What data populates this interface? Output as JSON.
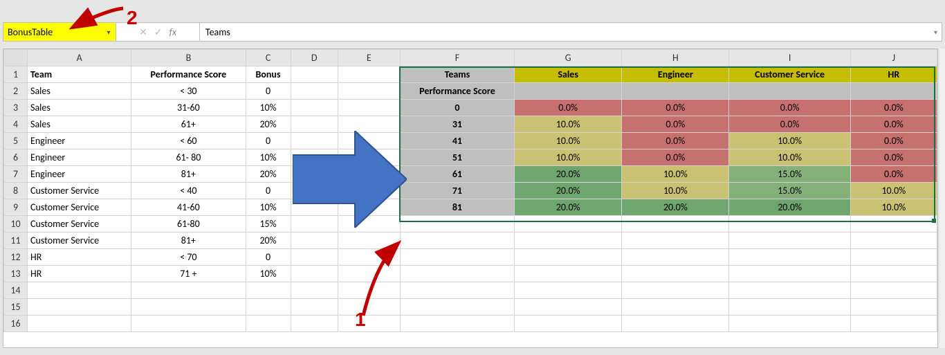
{
  "formula_bar": {
    "name_box": "BonusTable",
    "fx_label": "fx",
    "formula_value": "Teams"
  },
  "columns": [
    "A",
    "B",
    "C",
    "D",
    "E",
    "F",
    "G",
    "H",
    "I",
    "J"
  ],
  "row_numbers": [
    1,
    2,
    3,
    4,
    5,
    6,
    7,
    8,
    9,
    10,
    11,
    12,
    13,
    14,
    15,
    16
  ],
  "left_table": {
    "headers": {
      "team": "Team",
      "perf": "Performance Score",
      "bonus": "Bonus"
    },
    "rows": [
      {
        "team": "Sales",
        "perf": "< 30",
        "bonus": "0"
      },
      {
        "team": "Sales",
        "perf": "31-60",
        "bonus": "10%"
      },
      {
        "team": "Sales",
        "perf": "61+",
        "bonus": "20%"
      },
      {
        "team": "Engineer",
        "perf": "< 60",
        "bonus": "0"
      },
      {
        "team": "Engineer",
        "perf": "61- 80",
        "bonus": "10%"
      },
      {
        "team": "Engineer",
        "perf": "81+",
        "bonus": "20%"
      },
      {
        "team": "Customer Service",
        "perf": "< 40",
        "bonus": "0"
      },
      {
        "team": "Customer Service",
        "perf": "41-60",
        "bonus": "10%"
      },
      {
        "team": "Customer Service",
        "perf": "61-80",
        "bonus": "15%"
      },
      {
        "team": "Customer Service",
        "perf": "81+",
        "bonus": "20%"
      },
      {
        "team": "HR",
        "perf": "< 70",
        "bonus": "0"
      },
      {
        "team": "HR",
        "perf": "71 +",
        "bonus": "10%"
      }
    ]
  },
  "bonus_matrix": {
    "f1_label": "Teams",
    "team_headers": [
      "Sales",
      "Engineer",
      "Customer Service",
      "HR"
    ],
    "f2_label": "Performance Score",
    "scores": [
      "0",
      "31",
      "41",
      "51",
      "61",
      "71",
      "81"
    ],
    "values": [
      {
        "score": "0",
        "cells": [
          {
            "v": "0.0%",
            "c": "red"
          },
          {
            "v": "0.0%",
            "c": "red"
          },
          {
            "v": "0.0%",
            "c": "red"
          },
          {
            "v": "0.0%",
            "c": "red"
          }
        ]
      },
      {
        "score": "31",
        "cells": [
          {
            "v": "10.0%",
            "c": "yellow"
          },
          {
            "v": "0.0%",
            "c": "red"
          },
          {
            "v": "0.0%",
            "c": "red"
          },
          {
            "v": "0.0%",
            "c": "red"
          }
        ]
      },
      {
        "score": "41",
        "cells": [
          {
            "v": "10.0%",
            "c": "yellow"
          },
          {
            "v": "0.0%",
            "c": "red"
          },
          {
            "v": "10.0%",
            "c": "yellow"
          },
          {
            "v": "0.0%",
            "c": "red"
          }
        ]
      },
      {
        "score": "51",
        "cells": [
          {
            "v": "10.0%",
            "c": "yellow"
          },
          {
            "v": "0.0%",
            "c": "red"
          },
          {
            "v": "10.0%",
            "c": "yellow"
          },
          {
            "v": "0.0%",
            "c": "red"
          }
        ]
      },
      {
        "score": "61",
        "cells": [
          {
            "v": "20.0%",
            "c": "green"
          },
          {
            "v": "10.0%",
            "c": "yellow"
          },
          {
            "v": "15.0%",
            "c": "green2"
          },
          {
            "v": "0.0%",
            "c": "red"
          }
        ]
      },
      {
        "score": "71",
        "cells": [
          {
            "v": "20.0%",
            "c": "green"
          },
          {
            "v": "10.0%",
            "c": "yellow"
          },
          {
            "v": "15.0%",
            "c": "green2"
          },
          {
            "v": "10.0%",
            "c": "yellow"
          }
        ]
      },
      {
        "score": "81",
        "cells": [
          {
            "v": "20.0%",
            "c": "green"
          },
          {
            "v": "20.0%",
            "c": "green"
          },
          {
            "v": "20.0%",
            "c": "green"
          },
          {
            "v": "10.0%",
            "c": "yellow"
          }
        ]
      }
    ]
  },
  "annotations": {
    "num1": "1",
    "num2": "2"
  },
  "colors": {
    "highlight_yellow": "#ffff00",
    "olive_header": "#c4bd00",
    "grey_header": "#bfbfbf",
    "red": "#c77070",
    "yellow": "#cbc173",
    "green": "#6fa66f",
    "green2": "#86b07a",
    "arrow_blue": "#4472c4",
    "anno_red": "#c00000",
    "selection_green": "#1e7145"
  }
}
